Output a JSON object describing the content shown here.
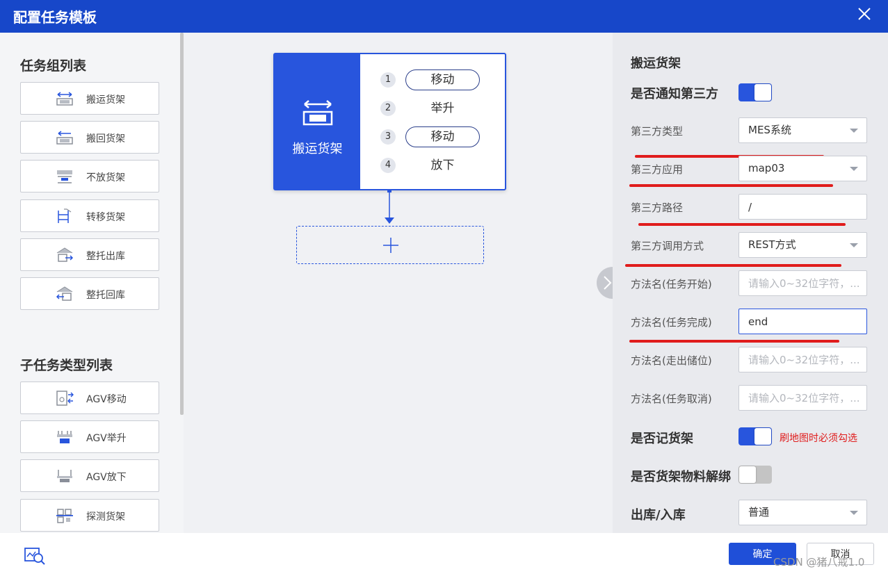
{
  "dialog": {
    "title": "配置任务模板"
  },
  "left": {
    "group_title": "任务组列表",
    "group_items": [
      {
        "label": "搬运货架",
        "icon": "shelf-transport-icon"
      },
      {
        "label": "搬回货架",
        "icon": "shelf-return-icon"
      },
      {
        "label": "不放货架",
        "icon": "shelf-no-place-icon"
      },
      {
        "label": "转移货架",
        "icon": "shelf-transfer-icon"
      },
      {
        "label": "整托出库",
        "icon": "pallet-outbound-icon"
      },
      {
        "label": "整托回库",
        "icon": "pallet-inbound-icon"
      }
    ],
    "subtask_title": "子任务类型列表",
    "subtask_items": [
      {
        "label": "AGV移动",
        "icon": "agv-move-icon"
      },
      {
        "label": "AGV举升",
        "icon": "agv-lift-icon"
      },
      {
        "label": "AGV放下",
        "icon": "agv-drop-icon"
      },
      {
        "label": "探测货架",
        "icon": "shelf-detect-icon"
      }
    ]
  },
  "canvas": {
    "task_label": "搬运货架",
    "steps": [
      {
        "num": "1",
        "label": "移动",
        "outlined": true
      },
      {
        "num": "2",
        "label": "举升",
        "outlined": false
      },
      {
        "num": "3",
        "label": "移动",
        "outlined": true
      },
      {
        "num": "4",
        "label": "放下",
        "outlined": false
      }
    ]
  },
  "right": {
    "title": "搬运货架",
    "notify_label": "是否通知第三方",
    "notify_on": true,
    "fields": [
      {
        "label": "第三方类型",
        "value": "MES系统",
        "type": "select",
        "placeholder": ""
      },
      {
        "label": "第三方应用",
        "value": "map03",
        "type": "select",
        "placeholder": ""
      },
      {
        "label": "第三方路径",
        "value": "/",
        "type": "input",
        "placeholder": ""
      },
      {
        "label": "第三方调用方式",
        "value": "REST方式",
        "type": "select",
        "placeholder": ""
      },
      {
        "label": "方法名(任务开始)",
        "value": "",
        "type": "input",
        "placeholder": "请输入0~32位字符，..."
      },
      {
        "label": "方法名(任务完成)",
        "value": "end",
        "type": "input",
        "placeholder": ""
      },
      {
        "label": "方法名(走出储位)",
        "value": "",
        "type": "input",
        "placeholder": "请输入0~32位字符，..."
      },
      {
        "label": "方法名(任务取消)",
        "value": "",
        "type": "input",
        "placeholder": "请输入0~32位字符，..."
      }
    ],
    "record_label": "是否记货架",
    "record_on": true,
    "record_hint": "刷地图时必须勾选",
    "unbind_label": "是否货架物料解绑",
    "unbind_on": false,
    "inout_label": "出库/入库",
    "inout_value": "普通"
  },
  "footer": {
    "ok_label": "确定",
    "cancel_label": "取消",
    "watermark": "CSDN @猪八戒1.0"
  },
  "colors": {
    "primary": "#1747c9",
    "accent": "#2855dd",
    "annotation": "#e01c1c"
  }
}
